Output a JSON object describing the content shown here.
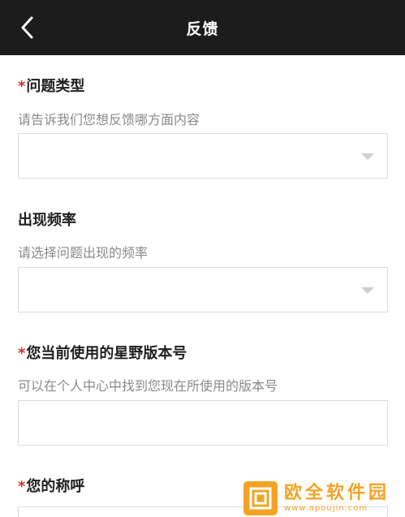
{
  "header": {
    "title": "反馈"
  },
  "form": {
    "required_mark": "*",
    "issue_type": {
      "label": "问题类型",
      "hint": "请告诉我们您想反馈哪方面内容",
      "value": ""
    },
    "frequency": {
      "label": "出现频率",
      "hint": "请选择问题出现的频率",
      "value": ""
    },
    "version": {
      "label": "您当前使用的星野版本号",
      "hint": "可以在个人中心中找到您现在所使用的版本号",
      "value": ""
    },
    "nickname": {
      "label": "您的称呼"
    }
  },
  "watermark": {
    "name": "欧全软件园",
    "url": "www.apoujin.com"
  },
  "colors": {
    "topbar": "#1c1c1c",
    "required": "#d0302b",
    "hint": "#8a8a8a",
    "border": "#dcdcdc",
    "watermark": "#f3a324"
  }
}
